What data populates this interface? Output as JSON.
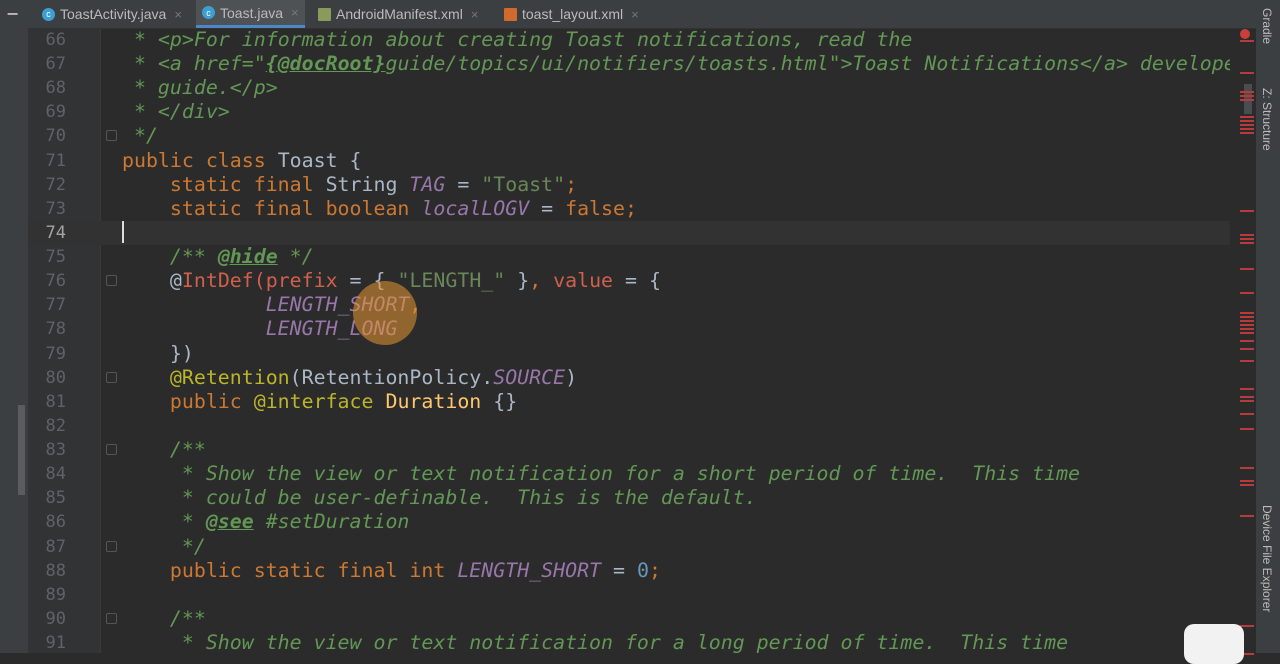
{
  "tabs": [
    {
      "label": "ToastActivity.java",
      "icon": "java-class-icon",
      "active": false
    },
    {
      "label": "Toast.java",
      "icon": "java-class-icon",
      "active": true
    },
    {
      "label": "AndroidManifest.xml",
      "icon": "manifest-icon",
      "active": false
    },
    {
      "label": "toast_layout.xml",
      "icon": "layout-xml-icon",
      "active": false
    }
  ],
  "tab_close": "×",
  "collapse_label": "−",
  "right_tools": {
    "gradle": "Gradle",
    "structure": "Z: Structure",
    "device": "Device File Explorer"
  },
  "current_line": 74,
  "lines": [
    {
      "n": "66",
      "fold": false,
      "t": [
        [
          "doc",
          " * "
        ],
        [
          "doc",
          "<p>"
        ],
        [
          "doc",
          "For information about creating Toast notifications, read the"
        ]
      ]
    },
    {
      "n": "67",
      "fold": false,
      "t": [
        [
          "doc",
          " * "
        ],
        [
          "doc",
          "<a href=\""
        ],
        [
          "doctag",
          "{@docRoot}"
        ],
        [
          "doc",
          "guide/topics/ui/notifiers/toasts.html\">"
        ],
        [
          "doc",
          "Toast Notifications</a> developer"
        ]
      ]
    },
    {
      "n": "68",
      "fold": false,
      "t": [
        [
          "doc",
          " * guide.</p>"
        ]
      ]
    },
    {
      "n": "69",
      "fold": false,
      "t": [
        [
          "doc",
          " * </div>"
        ]
      ]
    },
    {
      "n": "70",
      "fold": true,
      "t": [
        [
          "doc",
          " */"
        ]
      ]
    },
    {
      "n": "71",
      "fold": false,
      "t": [
        [
          "kw",
          "public class "
        ],
        [
          "plain",
          "Toast {"
        ]
      ]
    },
    {
      "n": "72",
      "fold": false,
      "t": [
        [
          "kw",
          "    static final "
        ],
        [
          "plain",
          "String "
        ],
        [
          "const",
          "TAG"
        ],
        [
          "plain",
          " = "
        ],
        [
          "str",
          "\"Toast\""
        ],
        [
          "kw",
          ";"
        ]
      ]
    },
    {
      "n": "73",
      "fold": false,
      "t": [
        [
          "kw",
          "    static final boolean "
        ],
        [
          "const",
          "localLOGV"
        ],
        [
          "plain",
          " = "
        ],
        [
          "kw",
          "false;"
        ]
      ]
    },
    {
      "n": "74",
      "fold": false,
      "t": []
    },
    {
      "n": "75",
      "fold": false,
      "t": [
        [
          "doc",
          "    /** "
        ],
        [
          "doctag",
          "@hide"
        ],
        [
          "doc",
          " */"
        ]
      ]
    },
    {
      "n": "76",
      "fold": true,
      "t": [
        [
          "plain",
          "    @"
        ],
        [
          "err",
          "IntDef(prefix"
        ],
        [
          "plain",
          " = { "
        ],
        [
          "str",
          "\"LENGTH_\""
        ],
        [
          "plain",
          " }"
        ],
        [
          "kw",
          ", "
        ],
        [
          "err",
          "value"
        ],
        [
          "plain",
          " = {"
        ]
      ]
    },
    {
      "n": "77",
      "fold": false,
      "t": [
        [
          "const",
          "            LENGTH_SHORT"
        ],
        [
          "kw",
          ","
        ]
      ]
    },
    {
      "n": "78",
      "fold": false,
      "t": [
        [
          "const",
          "            LENGTH_LONG"
        ]
      ]
    },
    {
      "n": "79",
      "fold": false,
      "t": [
        [
          "plain",
          "    })"
        ]
      ]
    },
    {
      "n": "80",
      "fold": true,
      "t": [
        [
          "ann",
          "    @Retention"
        ],
        [
          "plain",
          "(RetentionPolicy."
        ],
        [
          "const",
          "SOURCE"
        ],
        [
          "plain",
          ")"
        ]
      ]
    },
    {
      "n": "81",
      "fold": false,
      "t": [
        [
          "kw",
          "    public "
        ],
        [
          "ann",
          "@interface "
        ],
        [
          "cls",
          "Duration"
        ],
        [
          "plain",
          " {}"
        ]
      ]
    },
    {
      "n": "82",
      "fold": false,
      "t": []
    },
    {
      "n": "83",
      "fold": true,
      "t": [
        [
          "doc",
          "    /**"
        ]
      ]
    },
    {
      "n": "84",
      "fold": false,
      "t": [
        [
          "doc",
          "     * Show the view or text notification for a short period of time.  This time"
        ]
      ]
    },
    {
      "n": "85",
      "fold": false,
      "t": [
        [
          "doc",
          "     * could be user-definable.  This is the default."
        ]
      ]
    },
    {
      "n": "86",
      "fold": false,
      "t": [
        [
          "doc",
          "     * "
        ],
        [
          "doctag",
          "@see"
        ],
        [
          "doc",
          " #setDuration"
        ]
      ]
    },
    {
      "n": "87",
      "fold": true,
      "t": [
        [
          "doc",
          "     */"
        ]
      ]
    },
    {
      "n": "88",
      "fold": false,
      "t": [
        [
          "kw",
          "    public static final int "
        ],
        [
          "const",
          "LENGTH_SHORT"
        ],
        [
          "plain",
          " = "
        ],
        [
          "num",
          "0"
        ],
        [
          "kw",
          ";"
        ]
      ]
    },
    {
      "n": "89",
      "fold": false,
      "t": []
    },
    {
      "n": "90",
      "fold": true,
      "t": [
        [
          "doc",
          "    /**"
        ]
      ]
    },
    {
      "n": "91",
      "fold": false,
      "t": [
        [
          "doc",
          "     * Show the view or text notification for a long period of time.  This time"
        ]
      ]
    }
  ]
}
